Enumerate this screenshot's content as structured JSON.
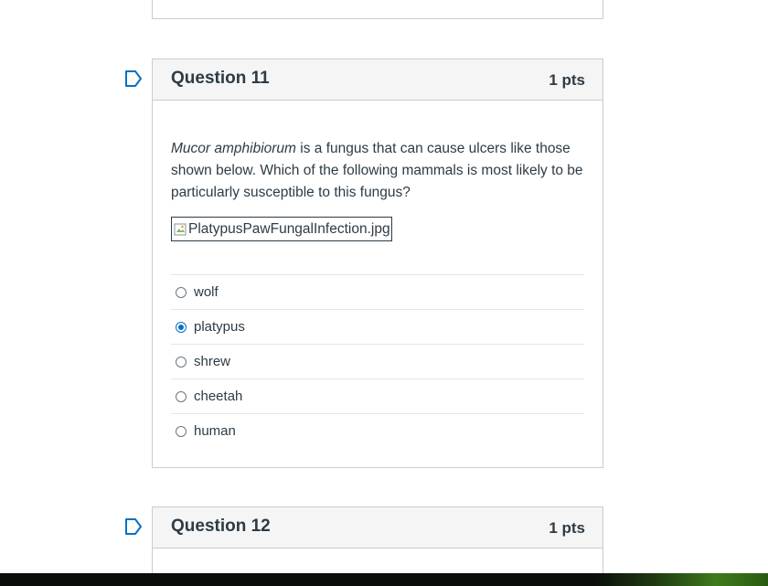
{
  "questions": [
    {
      "title": "Question 11",
      "points": "1 pts",
      "text_italic": "Mucor amphibiorum",
      "text_rest": " is a fungus that can cause ulcers like those shown below. Which of the following mammals is most likely to be particularly susceptible to this fungus?",
      "image_alt": "PlatypusPawFungalInfection.jpg",
      "answers": [
        {
          "label": "wolf",
          "selected": false
        },
        {
          "label": "platypus",
          "selected": true
        },
        {
          "label": "shrew",
          "selected": false
        },
        {
          "label": "cheetah",
          "selected": false
        },
        {
          "label": "human",
          "selected": false
        }
      ]
    },
    {
      "title": "Question 12",
      "points": "1 pts"
    }
  ],
  "icons": {
    "flag": "flag-icon",
    "broken_image": "broken-image-icon"
  },
  "colors": {
    "selected_radio": "#0770c6",
    "flag": "#0770c6",
    "text": "#2d3b45"
  }
}
